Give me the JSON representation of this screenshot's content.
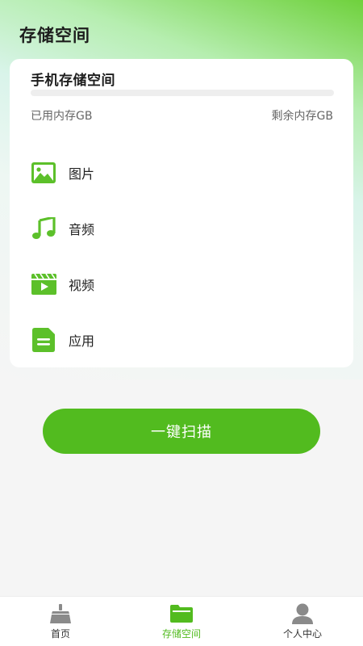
{
  "header": {
    "title": "存储空间"
  },
  "storage": {
    "title": "手机存储空间",
    "used_label": "已用内存GB",
    "free_label": "剩余内存GB",
    "used_fraction": 0
  },
  "categories": [
    {
      "label": "图片",
      "icon": "image-icon"
    },
    {
      "label": "音频",
      "icon": "music-note-icon"
    },
    {
      "label": "视频",
      "icon": "video-icon"
    },
    {
      "label": "应用",
      "icon": "app-document-icon"
    }
  ],
  "scan_button": {
    "label": "一键扫描"
  },
  "tabbar": {
    "tabs": [
      {
        "label": "首页",
        "icon": "broom-icon",
        "active": false
      },
      {
        "label": "存储空间",
        "icon": "folder-icon",
        "active": true
      },
      {
        "label": "个人中心",
        "icon": "person-icon",
        "active": false
      }
    ]
  },
  "colors": {
    "accent": "#52bb1f",
    "icon_green": "#5cc02a",
    "inactive_icon": "#8a8a8a"
  }
}
